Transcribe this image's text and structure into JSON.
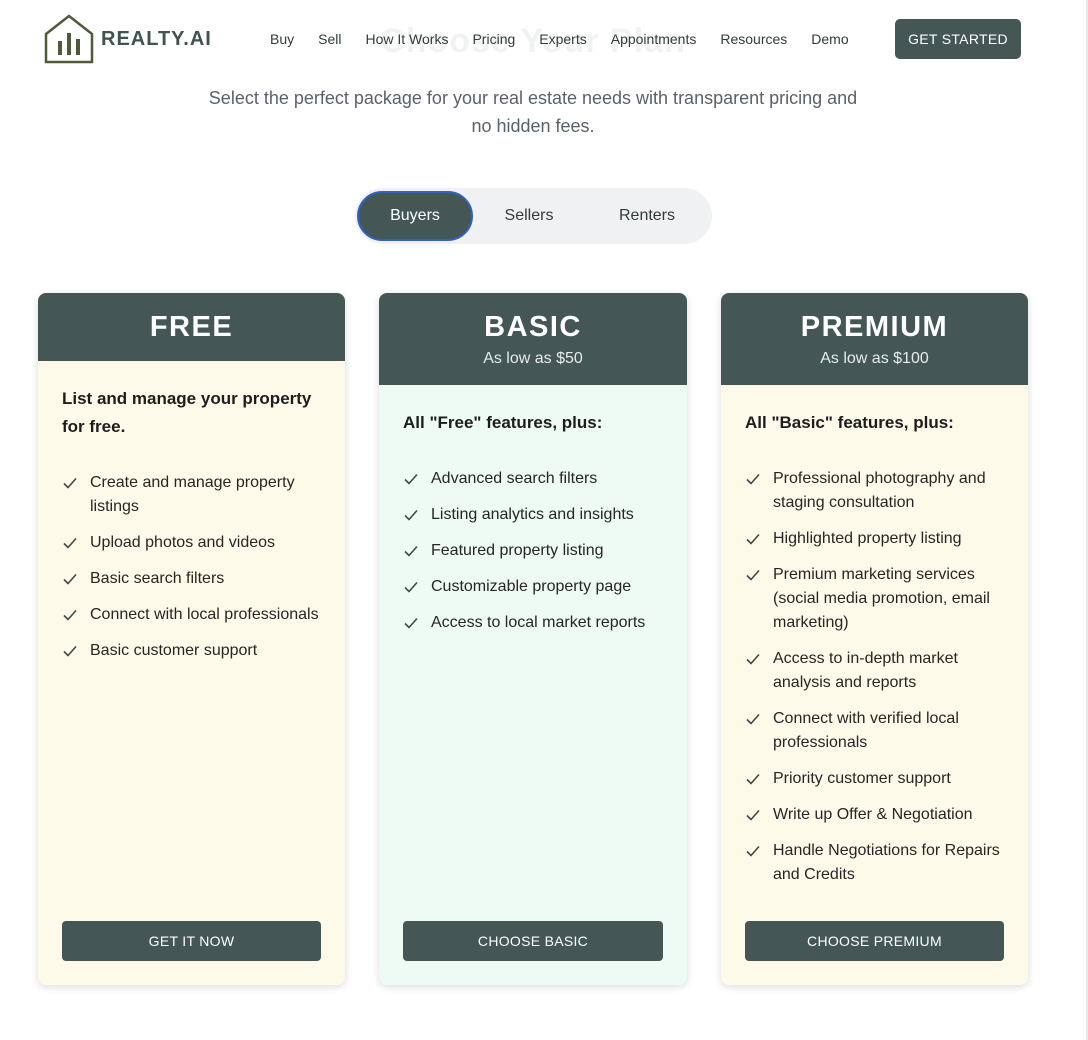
{
  "brand": {
    "name": "REALTY.AI"
  },
  "nav": {
    "items": [
      "Buy",
      "Sell",
      "How It Works",
      "Pricing",
      "Experts",
      "Appointments",
      "Resources",
      "Demo"
    ],
    "cta_label": "GET STARTED"
  },
  "hero": {
    "title": "Choose Your Plan",
    "subtitle": "Select the perfect package for your real estate needs with transparent pricing and no hidden fees."
  },
  "tabs": [
    {
      "label": "Buyers",
      "active": true
    },
    {
      "label": "Sellers",
      "active": false
    },
    {
      "label": "Renters",
      "active": false
    }
  ],
  "plans": {
    "free": {
      "title": "FREE",
      "intro": "List and manage your property for free.",
      "features": [
        "Create and manage property listings",
        "Upload photos and videos",
        "Basic search filters",
        "Connect with local professionals",
        "Basic customer support"
      ],
      "button": "GET IT NOW"
    },
    "basic": {
      "title": "BASIC",
      "price": "As low as $50",
      "intro": "All \"Free\" features, plus:",
      "features": [
        "Advanced search filters",
        "Listing analytics and insights",
        "Featured property listing",
        "Customizable property page",
        "Access to local market reports"
      ],
      "button": "CHOOSE BASIC"
    },
    "premium": {
      "title": "PREMIUM",
      "price": "As low as $100",
      "intro": "All \"Basic\" features, plus:",
      "features": [
        "Professional photography and staging consultation",
        "Highlighted property listing",
        "Premium marketing services (social media promotion, email marketing)",
        "Access to in-depth market analysis and reports",
        "Connect with verified local professionals",
        "Priority customer support",
        "Write up Offer & Negotiation",
        "Handle Negotiations for Repairs and Credits"
      ],
      "button": "CHOOSE PREMIUM"
    }
  },
  "colors": {
    "primary": "#455755",
    "card_cream": "#fefaea",
    "card_mint": "#eefaf4",
    "tab_focus": "#2f62c6"
  }
}
